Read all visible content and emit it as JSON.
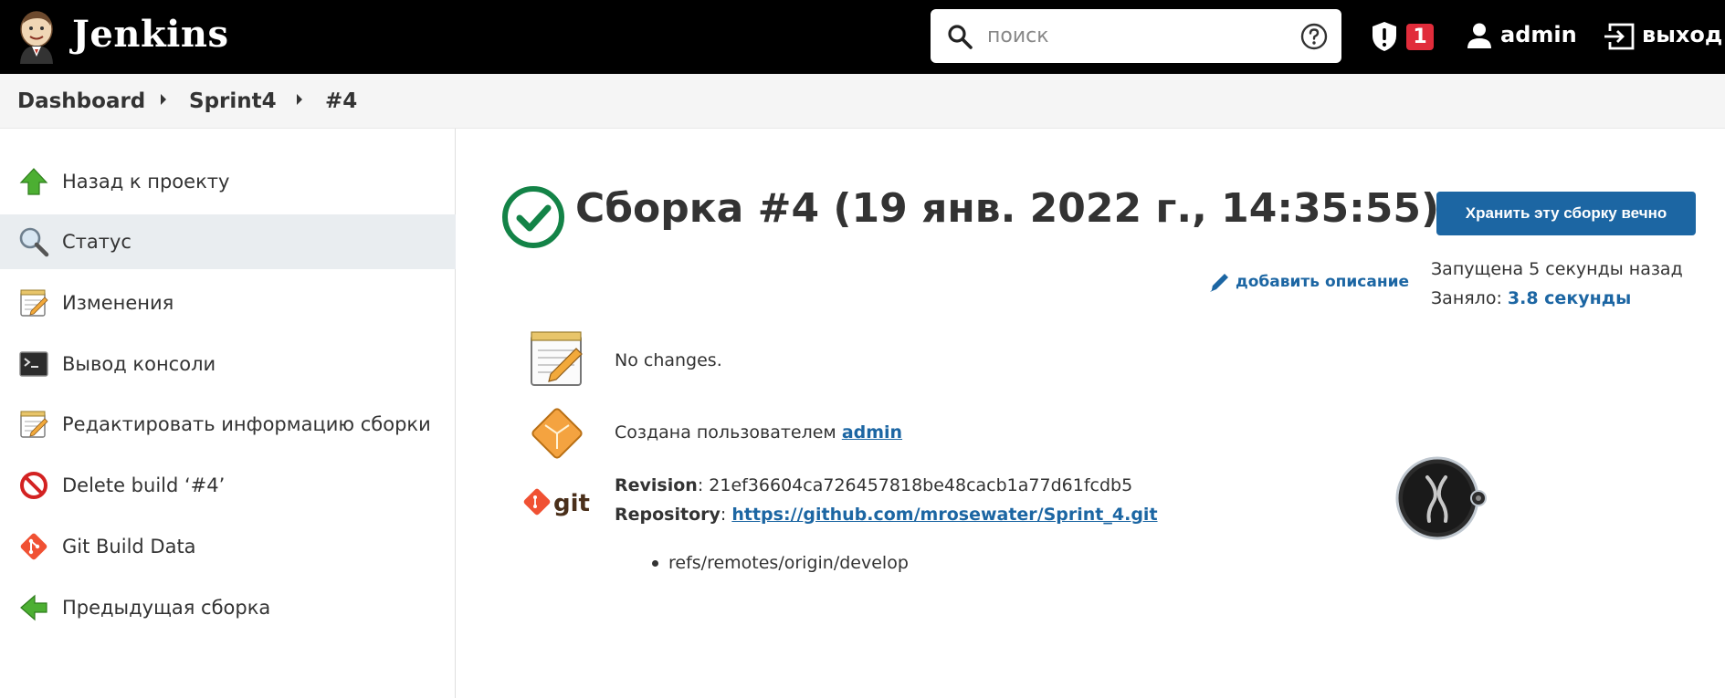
{
  "header": {
    "brand": "Jenkins",
    "search_placeholder": "поиск",
    "alert_count": "1",
    "user": "admin",
    "logout": "выход"
  },
  "breadcrumb": [
    "Dashboard",
    "Sprint4",
    "#4"
  ],
  "sidebar": {
    "items": [
      {
        "label": "Назад к проекту",
        "icon": "up-arrow-icon"
      },
      {
        "label": "Статус",
        "icon": "magnifier-icon"
      },
      {
        "label": "Изменения",
        "icon": "notepad-icon"
      },
      {
        "label": "Вывод консоли",
        "icon": "terminal-icon"
      },
      {
        "label": "Редактировать информацию сборки",
        "icon": "notepad-edit-icon"
      },
      {
        "label": "Delete build ‘#4’",
        "icon": "no-entry-icon"
      },
      {
        "label": "Git Build Data",
        "icon": "git-icon"
      },
      {
        "label": "Предыдущая сборка",
        "icon": "left-arrow-icon"
      }
    ]
  },
  "main": {
    "title": "Сборка #4 (19 янв. 2022 г., 14:35:55)",
    "keep_button": "Хранить эту сборку вечно",
    "add_description": "добавить описание",
    "started": "Запущена 5 секунды назад",
    "took_label": "Заняло: ",
    "took_value": "3.8 секунды",
    "no_changes": "No changes.",
    "created_by_label": "Создана пользователем ",
    "created_by_user": "admin",
    "revision_label": "Revision",
    "revision_value": ": 21ef36604ca726457818be48cacb1a77d61fcdb5",
    "repository_label": "Repository",
    "repository_sep": ": ",
    "repository_url": "https://github.com/mrosewater/Sprint_4.git",
    "ref": "refs/remotes/origin/develop"
  },
  "colors": {
    "header_bg": "#000000",
    "accent": "#1c66a3",
    "success": "#138347",
    "badge": "#e12c3b"
  }
}
